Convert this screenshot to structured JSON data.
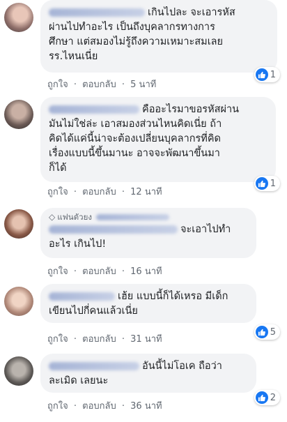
{
  "comments": [
    {
      "lines": [
        "เกินไปละ จะเอารหัส",
        "ผ่านไปทำอะไร เป็นถึงบุคลากรทางการ",
        "ศึกษา แต่สมองไม่รู้ถึงความเหมาะสมเลย",
        "รร.ไหนเนี่ย"
      ],
      "like": "ถูกใจ",
      "reply": "ตอบกลับ",
      "sep": "·",
      "time": "5 นาที",
      "reactions": "1"
    },
    {
      "lines": [
        "คืออะไรมาขอรหัสผ่าน",
        "มันไม่ใช่ล่ะ เอาสมองส่วนไหนคิดเนี่ย ถ้า",
        "คิดได้แค่นี้น่าจะต้องเปลี่ยนบุคลากรที่คิด",
        "เรื่องแบบนี้ขึ้นมานะ อาจจะพัฒนาขึ้นมา",
        "ก็ได้"
      ],
      "like": "ถูกใจ",
      "reply": "ตอบกลับ",
      "sep": "·",
      "time": "12 นาที",
      "reactions": "1"
    },
    {
      "badge": "แฟนตัวยง",
      "lines": [
        "จะเอาไปทำ",
        "อะไร เกินไป!"
      ],
      "like": "ถูกใจ",
      "reply": "ตอบกลับ",
      "sep": "·",
      "time": "16 นาที"
    },
    {
      "lines": [
        "เฮ้ย แบบนี้ก็ได้เหรอ มีเด็ก",
        "เขียนไปกี่คนแล้วเนี่ย"
      ],
      "like": "ถูกใจ",
      "reply": "ตอบกลับ",
      "sep": "·",
      "time": "31 นาที",
      "reactions": "5"
    },
    {
      "lines": [
        "อันนี้ไม่โอเค ถือว่า",
        "ละเมิด เลยนะ"
      ],
      "like": "ถูกใจ",
      "reply": "ตอบกลับ",
      "sep": "·",
      "time": "36 นาที",
      "reactions": "2"
    }
  ],
  "colors": {
    "bubble": "#f2f3f5",
    "like_blue": "#1877f2",
    "meta": "#606770"
  }
}
